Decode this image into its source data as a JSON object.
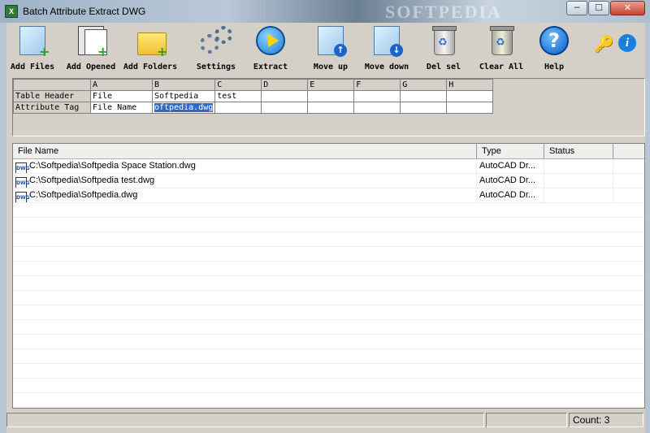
{
  "window": {
    "title": "Batch Attribute Extract DWG",
    "watermark": "SOFTPEDIA",
    "minimize": "─",
    "maximize": "☐",
    "close": "✕"
  },
  "toolbar": {
    "buttons": [
      {
        "label": "Add Files",
        "icon": "add-files-icon"
      },
      {
        "label": "Add Opened",
        "icon": "add-opened-icon"
      },
      {
        "label": "Add Folders",
        "icon": "add-folders-icon"
      },
      {
        "label": "Settings",
        "icon": "gears-icon"
      },
      {
        "label": "Extract",
        "icon": "play-icon"
      },
      {
        "label": "Move up",
        "icon": "move-up-icon"
      },
      {
        "label": "Move down",
        "icon": "move-down-icon"
      },
      {
        "label": "Del sel",
        "icon": "recycle-bin-icon"
      },
      {
        "label": "Clear All",
        "icon": "recycle-bin-full-icon"
      },
      {
        "label": "Help",
        "icon": "help-icon"
      }
    ],
    "extra_icons": [
      "keys-icon",
      "info-icon"
    ],
    "info_glyph": "i"
  },
  "attribute_grid": {
    "columns": [
      "",
      "A",
      "B",
      "C",
      "D",
      "E",
      "F",
      "G",
      "H"
    ],
    "rows": [
      {
        "header": "Table Header",
        "cells": [
          "File",
          "Softpedia",
          "test",
          "",
          "",
          "",
          "",
          ""
        ]
      },
      {
        "header": "Attribute Tag",
        "cells": [
          "File Name",
          "oftpedia.dwg",
          "",
          "",
          "",
          "",
          "",
          ""
        ]
      }
    ]
  },
  "file_list": {
    "columns": [
      "File Name",
      "Type",
      "Status"
    ],
    "rows": [
      {
        "name": "C:\\Softpedia\\Softpedia Space Station.dwg",
        "type": "AutoCAD Dr...",
        "status": ""
      },
      {
        "name": "C:\\Softpedia\\Softpedia test.dwg",
        "type": "AutoCAD Dr...",
        "status": ""
      },
      {
        "name": "C:\\Softpedia\\Softpedia.dwg",
        "type": "AutoCAD Dr...",
        "status": ""
      }
    ]
  },
  "statusbar": {
    "count_label": "Count:",
    "count_value": "3"
  },
  "colors": {
    "selection": "#316ac5",
    "window_bg": "#d4d0c8"
  }
}
